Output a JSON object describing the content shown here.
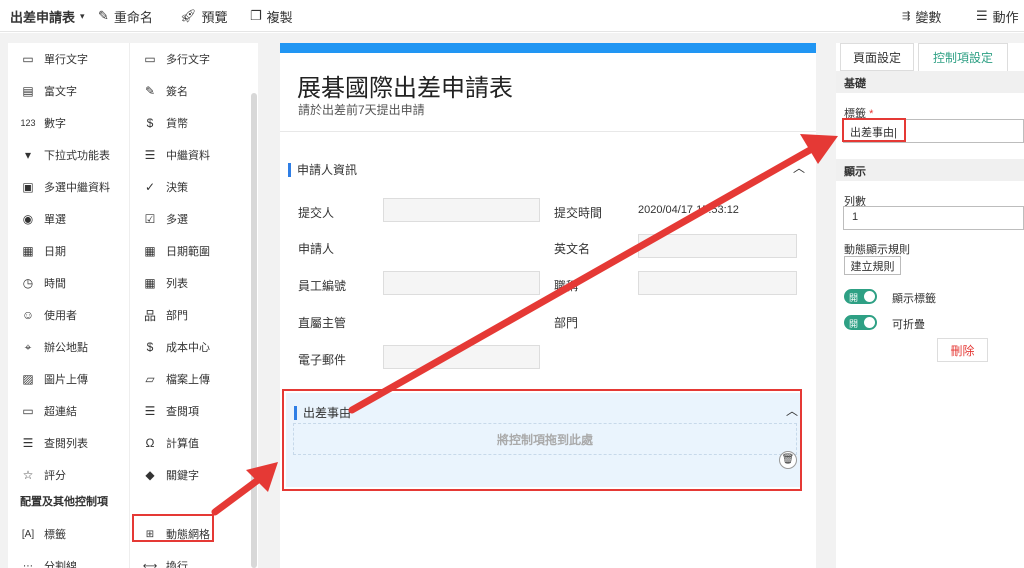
{
  "toolbar": {
    "title": "出差申請表",
    "rename": "重命名",
    "preview": "預覽",
    "copy": "複製",
    "variables": "變數",
    "actions": "動作"
  },
  "palette": {
    "items": [
      {
        "label": "單行文字",
        "icon": "▭"
      },
      {
        "label": "多行文字",
        "icon": "▭"
      },
      {
        "label": "富文字",
        "icon": "▤"
      },
      {
        "label": "簽名",
        "icon": "✎"
      },
      {
        "label": "數字",
        "icon": "123"
      },
      {
        "label": "貨幣",
        "icon": "$"
      },
      {
        "label": "下拉式功能表",
        "icon": "▾"
      },
      {
        "label": "中繼資料",
        "icon": "☰"
      },
      {
        "label": "多選中繼資料",
        "icon": "▣"
      },
      {
        "label": "決策",
        "icon": "✓"
      },
      {
        "label": "單選",
        "icon": "◉"
      },
      {
        "label": "多選",
        "icon": "☑"
      },
      {
        "label": "日期",
        "icon": "▦"
      },
      {
        "label": "日期範圍",
        "icon": "▦"
      },
      {
        "label": "時間",
        "icon": "◷"
      },
      {
        "label": "列表",
        "icon": "▦"
      },
      {
        "label": "使用者",
        "icon": "☺"
      },
      {
        "label": "部門",
        "icon": "品"
      },
      {
        "label": "辦公地點",
        "icon": "⌖"
      },
      {
        "label": "成本中心",
        "icon": "$"
      },
      {
        "label": "圖片上傳",
        "icon": "▨"
      },
      {
        "label": "檔案上傳",
        "icon": "▱"
      },
      {
        "label": "超連結",
        "icon": "▭"
      },
      {
        "label": "查閱項",
        "icon": "☰"
      },
      {
        "label": "查閱列表",
        "icon": "☰"
      },
      {
        "label": "計算值",
        "icon": "Ω"
      },
      {
        "label": "評分",
        "icon": "☆"
      },
      {
        "label": "關鍵字",
        "icon": "◆"
      }
    ],
    "section_header": "配置及其他控制項",
    "layout_items": [
      {
        "label": "標籤",
        "icon": "[A]"
      },
      {
        "label": "動態網格",
        "icon": "⊞"
      },
      {
        "label": "分割線",
        "icon": "⋯"
      },
      {
        "label": "換行",
        "icon": "⟷"
      }
    ]
  },
  "form": {
    "title": "展碁國際出差申請表",
    "subtitle": "請於出差前7天提出申請",
    "applicant_section": "申請人資訊",
    "fields": {
      "submitter": "提交人",
      "submit_time": "提交時間",
      "submit_time_value": "2020/04/17 15:53:12",
      "applicant": "申請人",
      "english_name": "英文名",
      "employee_id": "員工編號",
      "title": "職稱",
      "supervisor": "直屬主管",
      "department": "部門",
      "email": "電子郵件"
    },
    "reason_section": "出差事由",
    "drop_hint": "將控制項拖到此處"
  },
  "right_panel": {
    "tabs": [
      "頁面設定",
      "控制項設定"
    ],
    "basic": "基礎",
    "label_caption": "標籤",
    "label_value": "出差事由",
    "display": "顯示",
    "columns_caption": "列數",
    "columns_value": "1",
    "dynamic_rule": "動態顯示規則",
    "create_rule": "建立規則",
    "toggle_text": "開",
    "show_label": "顯示標籤",
    "collapsible": "可折疊",
    "delete": "刪除"
  },
  "colors": {
    "accent": "#2196f3",
    "annotation": "#e53935",
    "toggle": "#2ea084",
    "active_tab": "#2ea084"
  }
}
